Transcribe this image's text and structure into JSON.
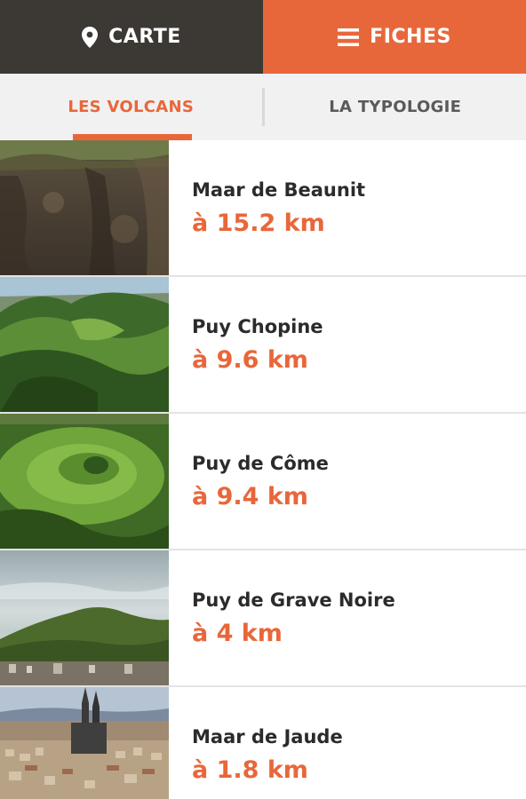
{
  "nav": {
    "carte_label": "CARTE",
    "fiches_label": "FICHES",
    "carte_icon": "map-pin-icon",
    "fiches_icon": "menu-icon",
    "active": "FICHES"
  },
  "subtabs": {
    "volcans_label": "LES VOLCANS",
    "typologie_label": "LA TYPOLOGIE",
    "active": "LES VOLCANS"
  },
  "colors": {
    "accent": "#e8673a",
    "dark": "#3c3934"
  },
  "volcanoes": [
    {
      "name": "Maar de Beaunit",
      "distance": "à 15.2 km"
    },
    {
      "name": "Puy Chopine",
      "distance": "à 9.6 km"
    },
    {
      "name": "Puy de Côme",
      "distance": "à 9.4 km"
    },
    {
      "name": "Puy de Grave Noire",
      "distance": "à 4 km"
    },
    {
      "name": "Maar de Jaude",
      "distance": "à 1.8 km"
    }
  ]
}
